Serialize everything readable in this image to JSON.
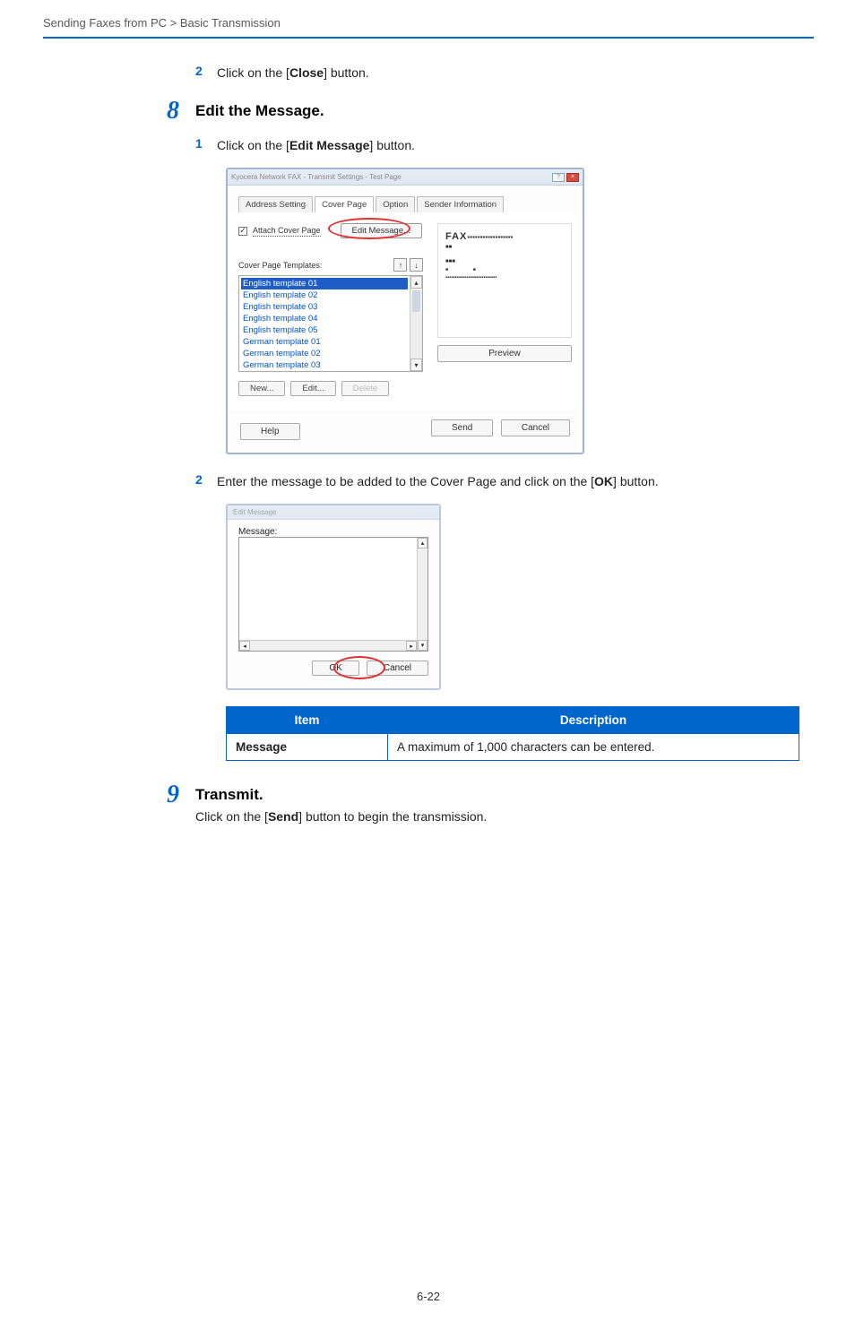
{
  "breadcrumb": "Sending Faxes from PC > Basic Transmission",
  "step7": {
    "s2": {
      "num": "2",
      "text_a": "Click on the [",
      "bold": "Close",
      "text_b": "] button."
    }
  },
  "step8": {
    "num": "8",
    "title": "Edit the Message.",
    "s1": {
      "num": "1",
      "text_a": "Click on the [",
      "bold": "Edit Message",
      "text_b": "] button."
    },
    "dialog": {
      "titlebar": "Kyocera Network FAX - Transmit Settings - Test Page",
      "tabs": {
        "t1": "Address Setting",
        "t2": "Cover Page",
        "t3": "Option",
        "t4": "Sender Information"
      },
      "attach_label": "Attach Cover Page",
      "editmsg_btn": "Edit Message...",
      "templates_label": "Cover Page Templates:",
      "items": [
        "English template 01",
        "English template 02",
        "English template 03",
        "English template 04",
        "English template 05",
        "German template 01",
        "German template 02",
        "German template 03"
      ],
      "new_btn": "New...",
      "edit_btn": "Edit...",
      "delete_btn": "Delete",
      "fax_label": "FAX",
      "preview_btn": "Preview",
      "help_btn": "Help",
      "send_btn": "Send",
      "cancel_btn": "Cancel"
    },
    "s2": {
      "num": "2",
      "text_a": "Enter the message to be added to the Cover Page and click on the [",
      "bold": "OK",
      "text_b": "] button."
    },
    "msgdialog": {
      "title": "Edit Message",
      "label": "Message:",
      "ok": "OK",
      "cancel": "Cancel"
    },
    "table": {
      "h1": "Item",
      "h2": "Description",
      "r1c1": "Message",
      "r1c2": "A maximum of 1,000 characters can be entered."
    }
  },
  "step9": {
    "num": "9",
    "title": "Transmit.",
    "body_a": "Click on the [",
    "body_bold": "Send",
    "body_b": "] button to begin the transmission."
  },
  "footer": "6-22"
}
